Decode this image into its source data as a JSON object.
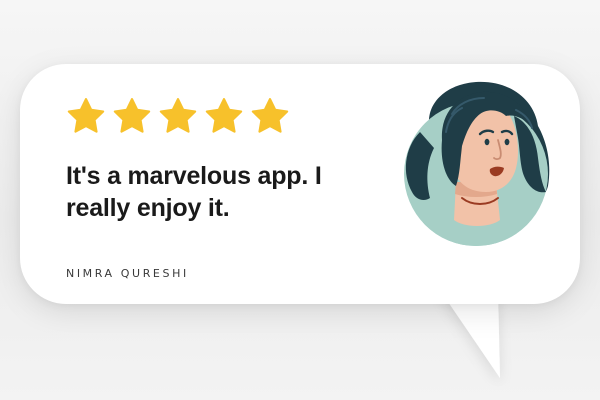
{
  "review": {
    "rating": 5,
    "max_rating": 5,
    "quote": "It's a marvelous app. I really enjoy it.",
    "author": "NIMRA QURESHI"
  },
  "colors": {
    "star": "#f7c12b",
    "text": "#1a1a1a",
    "avatar_bg": "#a6cfc6",
    "hair": "#1f3d47",
    "skin": "#f2c2a8",
    "lips": "#9a3b22"
  },
  "icons": {
    "rating": "star-icon",
    "avatar": "woman-avatar-icon"
  }
}
